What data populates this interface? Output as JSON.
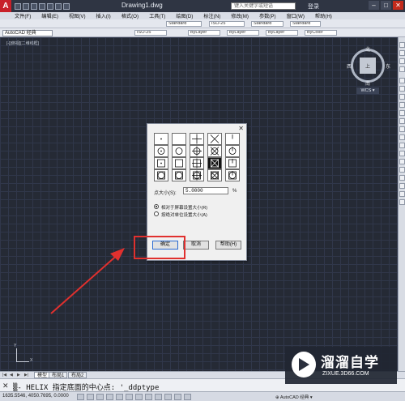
{
  "titlebar": {
    "logo": "A",
    "doc_title": "Drawing1.dwg",
    "search_placeholder": "键入关键字或短语",
    "login": "登录",
    "minimize": "–",
    "maximize": "□",
    "close": "✕"
  },
  "menu": [
    "文件(F)",
    "编辑(E)",
    "视图(V)",
    "插入(I)",
    "格式(O)",
    "工具(T)",
    "绘图(D)",
    "标注(N)",
    "修改(M)",
    "参数(P)",
    "窗口(W)",
    "帮助(H)"
  ],
  "toolbar": {
    "text_style": "Standard",
    "dim_style": "ISO-25",
    "table_style": "Standard",
    "mleader_style": "Standard",
    "layer_color": "ByLayer",
    "linetype": "ByLayer",
    "lineweight": "ByLayer",
    "plot_style": "ByColor",
    "workspace": "AutoCAD 经典",
    "dim_style2": "ISO-25"
  },
  "viewport": {
    "label": "[-][俯视][二维线框]"
  },
  "viewcube": {
    "north": "北",
    "south": "南",
    "west": "西",
    "east": "东",
    "top": "上",
    "wcs": "WCS ▾"
  },
  "ucs": {
    "x": "X",
    "y": "Y"
  },
  "tabs": [
    {
      "label": "模型",
      "active": true
    },
    {
      "label": "布局1",
      "active": false
    },
    {
      "label": "布局2",
      "active": false
    }
  ],
  "tab_nav": [
    "|◀",
    "◀",
    "▶",
    "▶|"
  ],
  "command": {
    "close": "✕",
    "text": "▒- HELIX 指定底面的中心点: '_ddptype"
  },
  "status": {
    "coords": "1635.5546, 4050.7695, 0.0000",
    "right": "⊕ AutoCAD 经典 ▾"
  },
  "watermark": {
    "title": "溜溜自学",
    "url": "ZIXUE.3D66.COM"
  },
  "dialog": {
    "close": "✕",
    "size_label": "点大小(S):",
    "size_value": "5.0000",
    "size_unit": "%",
    "radio_relative": "相对于屏幕设置大小(R)",
    "radio_absolute": "按绝对单位设置大小(A)",
    "ok": "确定",
    "cancel": "取消",
    "help": "帮助(H)",
    "selected_index": 13,
    "styles": [
      "dot",
      "none",
      "plus",
      "x",
      "tick",
      "circle",
      "circle-none",
      "circle-plus",
      "circle-x",
      "circle-tick",
      "square",
      "square-none",
      "square-plus",
      "square-x",
      "square-tick",
      "sq-circle",
      "sq-circle-none",
      "sq-circle-plus",
      "sq-circle-x",
      "sq-circle-tick"
    ]
  },
  "annotation_color": "#e0302e"
}
